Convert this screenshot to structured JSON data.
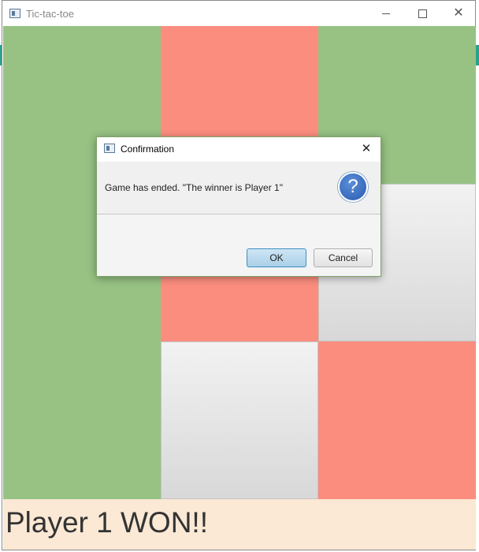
{
  "window": {
    "title": "Tic-tac-toe",
    "icon": "app-window-icon",
    "controls": [
      "minimize",
      "maximize",
      "close"
    ]
  },
  "board": {
    "cells": [
      {
        "row": 1,
        "col": 1,
        "state": "green"
      },
      {
        "row": 1,
        "col": 2,
        "state": "red"
      },
      {
        "row": 1,
        "col": 3,
        "state": "green"
      },
      {
        "row": 2,
        "col": 1,
        "state": "green"
      },
      {
        "row": 2,
        "col": 2,
        "state": "red"
      },
      {
        "row": 2,
        "col": 3,
        "state": "empty"
      },
      {
        "row": 3,
        "col": 1,
        "state": "green"
      },
      {
        "row": 3,
        "col": 2,
        "state": "empty"
      },
      {
        "row": 3,
        "col": 3,
        "state": "red"
      }
    ],
    "colors": {
      "green": "#97c283",
      "red": "#fb8d7f",
      "empty": "#e6e6e6"
    }
  },
  "status": {
    "text": "Player 1 WON!!",
    "background": "#fbe8d5"
  },
  "dialog": {
    "title": "Confirmation",
    "message": "Game has ended. \"The winner is Player 1\"",
    "icon": "question-icon",
    "ok_label": "OK",
    "cancel_label": "Cancel",
    "close_symbol": "✕"
  }
}
